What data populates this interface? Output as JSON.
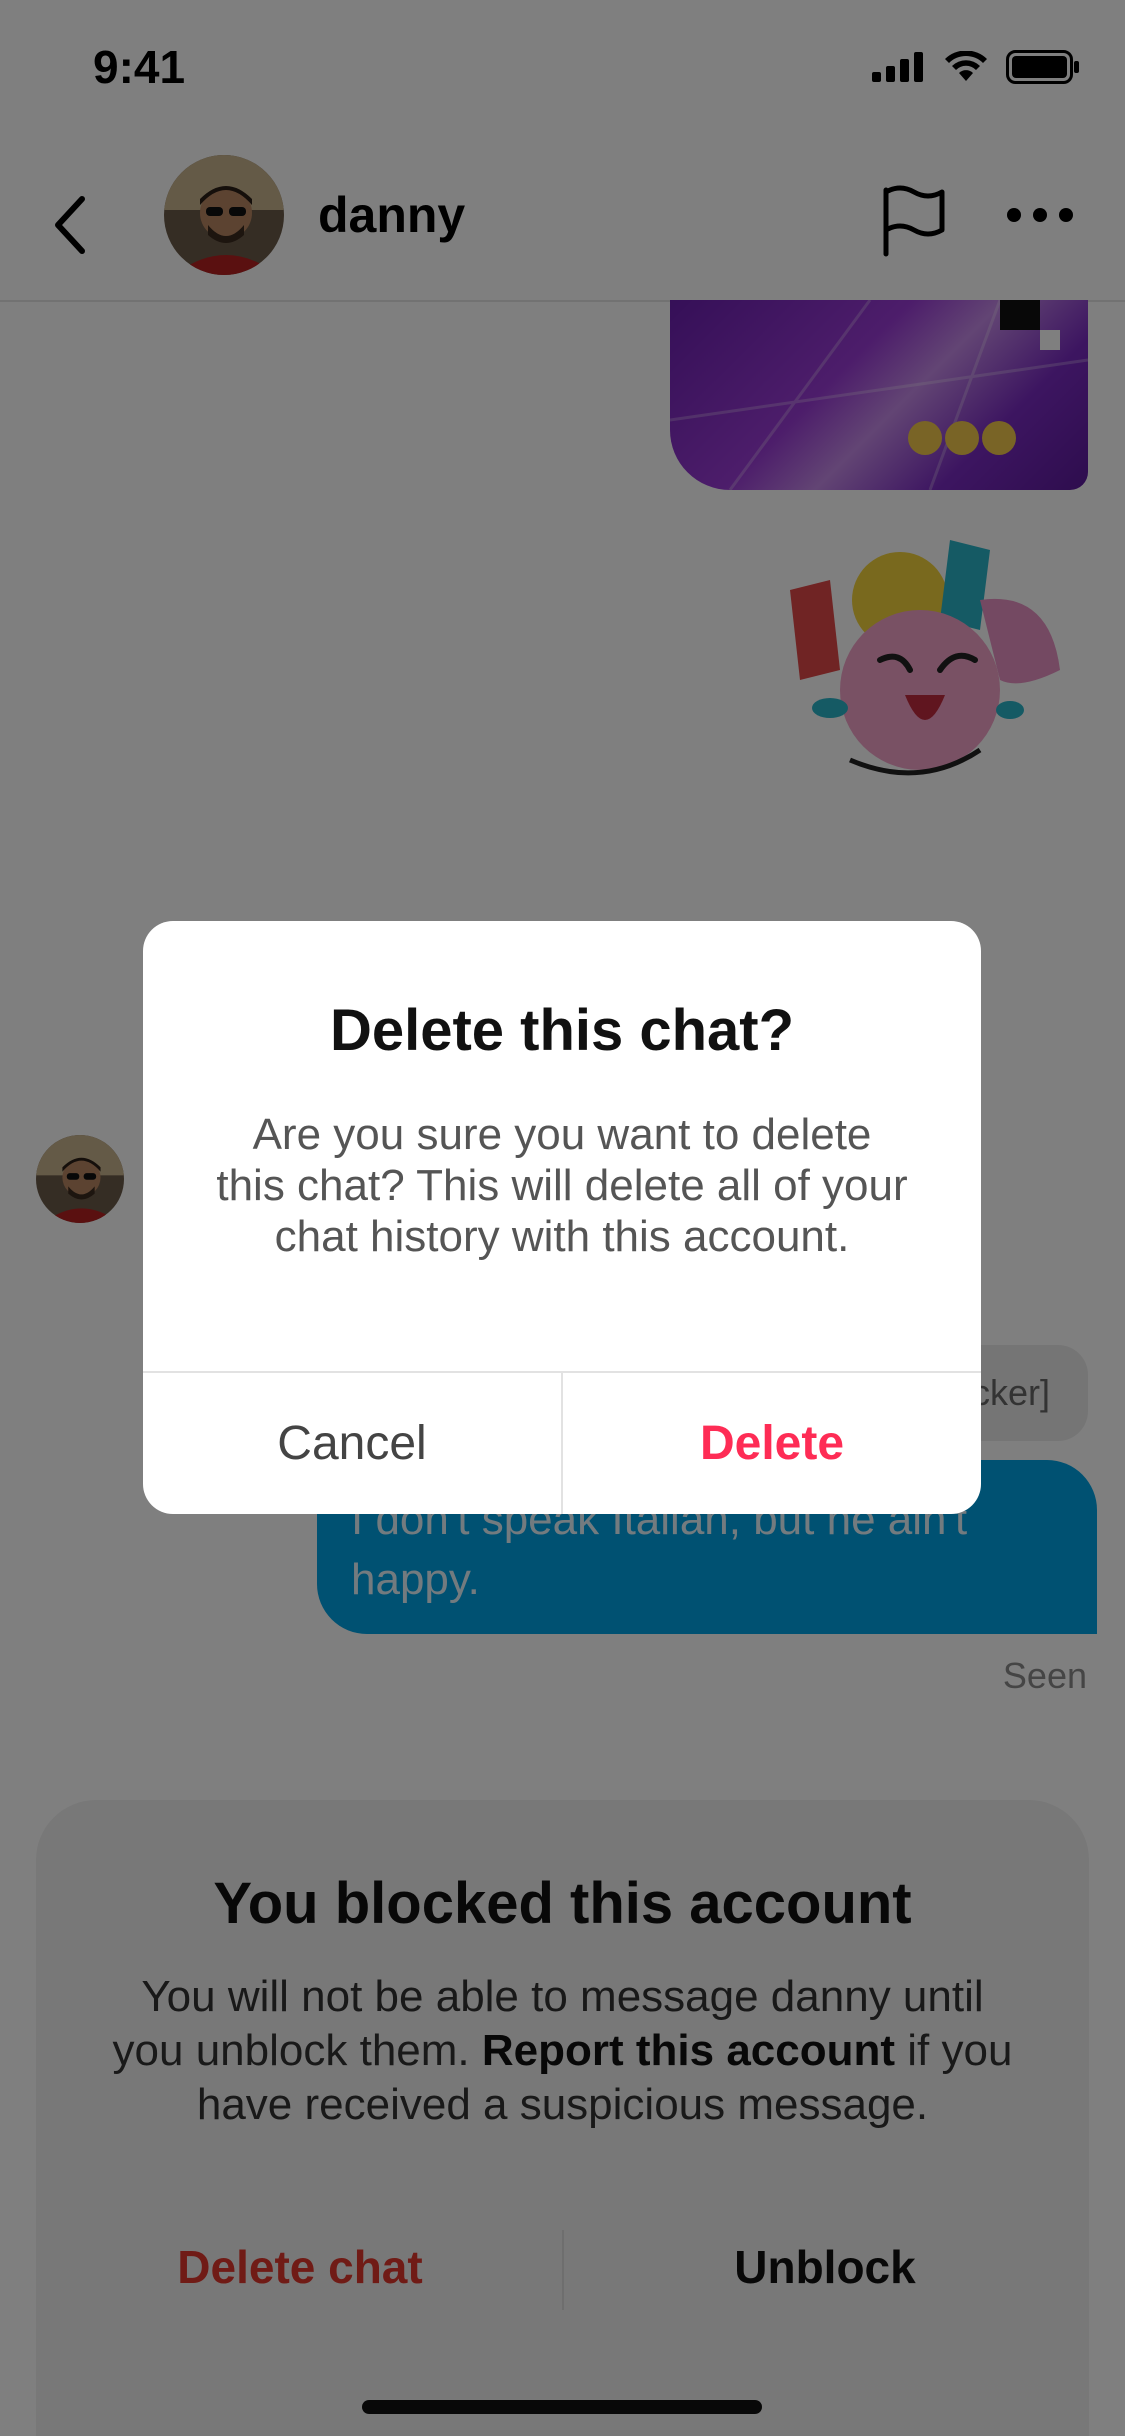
{
  "status_bar": {
    "time": "9:41"
  },
  "header": {
    "name": "danny"
  },
  "chat": {
    "partial_bubble_text": "[Sticker]",
    "blue_bubble_text": "I don't speak Italian, but he ain't happy.",
    "seen_label": "Seen"
  },
  "blocked_panel": {
    "title": "You blocked this account",
    "text_before": "You will not be able to message danny until you unblock them.",
    "report_link": "Report this account",
    "text_after": "if you have received a suspicious message.",
    "delete_chat_label": "Delete chat",
    "unblock_label": "Unblock"
  },
  "modal": {
    "title": "Delete this chat?",
    "body": "Are you sure you want to delete this chat? This will delete all of your chat history with this account.",
    "cancel_label": "Cancel",
    "delete_label": "Delete"
  },
  "colors": {
    "destructive": "#fe2c55",
    "bubble_blue": "#00a2e4"
  }
}
